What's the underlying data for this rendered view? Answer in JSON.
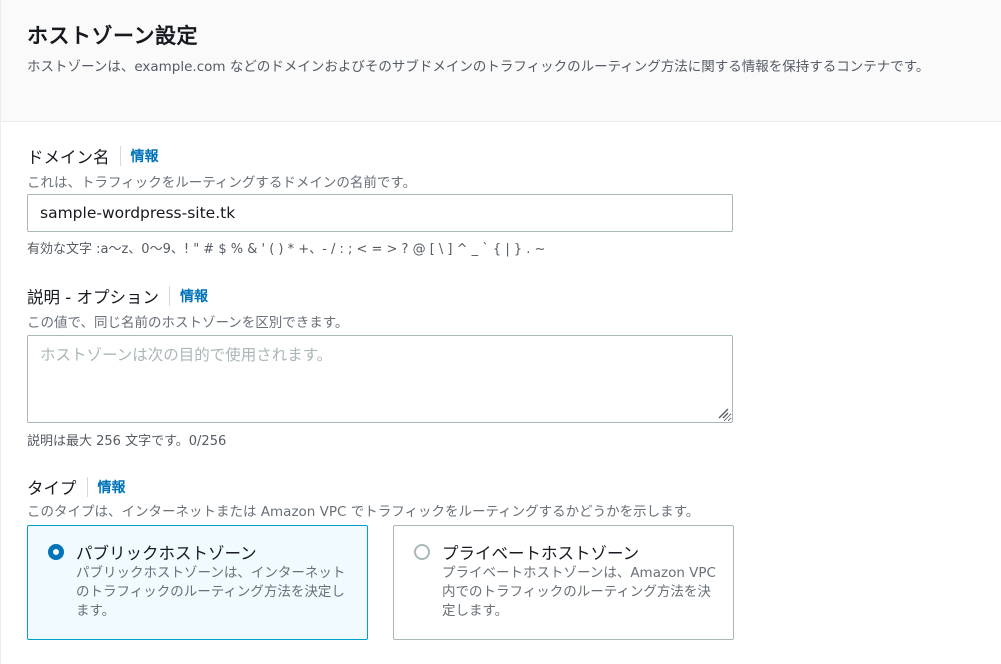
{
  "header": {
    "title": "ホストゾーン設定",
    "description": "ホストゾーンは、example.com などのドメインおよびそのサブドメインのトラフィックのルーティング方法に関する情報を保持するコンテナです。"
  },
  "domain": {
    "label": "ドメイン名",
    "info": "情報",
    "description": "これは、トラフィックをルーティングするドメインの名前です。",
    "value": "sample-wordpress-site.tk",
    "hint": "有効な文字 :a〜z、0〜9、! \" # $ % & ' ( ) * +、- / : ; < = > ? @ [ \\ ] ^ _ ` { | } . ~"
  },
  "comment": {
    "label": "説明 - オプション",
    "info": "情報",
    "description": "この値で、同じ名前のホストゾーンを区別できます。",
    "placeholder": "ホストゾーンは次の目的で使用されます。",
    "value": "",
    "hint": "説明は最大 256 文字です。0/256"
  },
  "type": {
    "label": "タイプ",
    "info": "情報",
    "description": "このタイプは、インターネットまたは Amazon VPC でトラフィックをルーティングするかどうかを示します。",
    "options": [
      {
        "title": "パブリックホストゾーン",
        "description": "パブリックホストゾーンは、インターネットのトラフィックのルーティング方法を決定します。",
        "selected": true
      },
      {
        "title": "プライベートホストゾーン",
        "description": "プライベートホストゾーンは、Amazon VPC 内でのトラフィックのルーティング方法を決定します。",
        "selected": false
      }
    ]
  },
  "colors": {
    "link": "#0073bb",
    "selected_border": "#00a1c9",
    "selected_bg": "#f1faff",
    "text": "#16191f",
    "secondary_text": "#687078"
  }
}
